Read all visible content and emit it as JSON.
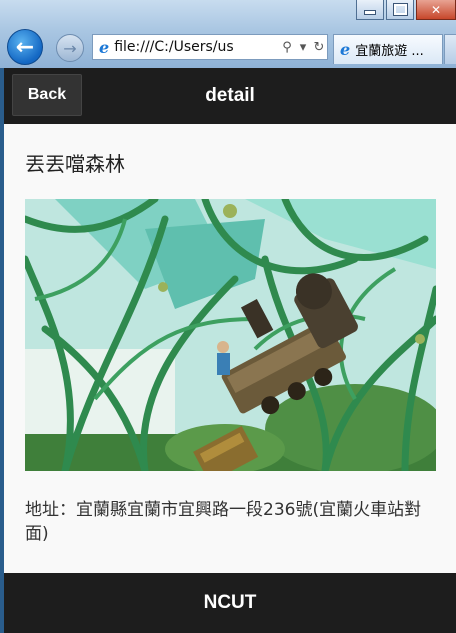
{
  "browser": {
    "address": "file:///C:/Users/us",
    "tab_title": "宜蘭旅遊 ...",
    "icons": {
      "back": "back-arrow-icon",
      "forward": "forward-arrow-icon",
      "ie": "internet-explorer-icon",
      "search": "search-icon",
      "refresh": "refresh-icon"
    }
  },
  "header": {
    "back_label": "Back",
    "title": "detail"
  },
  "detail": {
    "name": "丟丟噹森林",
    "image_alt": "丟丟噹森林 photo",
    "address": "地址：宜蘭縣宜蘭市宜興路一段236號(宜蘭火車站對面)"
  },
  "footer": {
    "text": "NCUT"
  },
  "colors": {
    "bar": "#1d1d1d",
    "page_bg": "#f9f9f9",
    "text": "#333333"
  }
}
